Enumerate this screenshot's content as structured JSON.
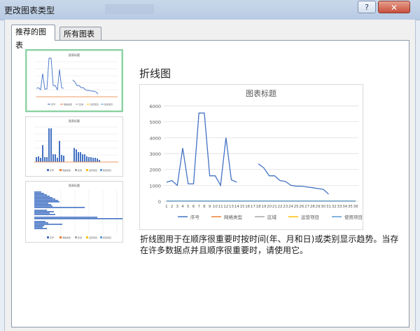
{
  "window": {
    "title": "更改图表类型",
    "help_label": "?",
    "close_label": "✕"
  },
  "tabs": [
    {
      "label": "推荐的图表",
      "active": true
    },
    {
      "label": "所有图表",
      "active": false
    }
  ],
  "selected_chart": {
    "type_name": "折线图",
    "description": "折线图用于在顺序很重要时按时间(年、月和日)或类别显示趋势。当存在许多数据点并且顺序很重要时，请使用它。"
  },
  "chart_data": {
    "type": "line",
    "title": "图表标题",
    "categories": [
      "1",
      "2",
      "3",
      "4",
      "5",
      "6",
      "7",
      "8",
      "9",
      "10",
      "11",
      "12",
      "13",
      "14",
      "15",
      "16",
      "17",
      "18",
      "19",
      "20",
      "21",
      "22",
      "23",
      "24",
      "25",
      "26",
      "27",
      "28",
      "29",
      "30",
      "31",
      "32",
      "33",
      "34",
      "35",
      "36"
    ],
    "ylim": [
      0,
      6000
    ],
    "yticks": [
      0,
      1000,
      2000,
      3000,
      4000,
      5000,
      6000
    ],
    "grid": true,
    "legend_position": "bottom",
    "series": [
      {
        "name": "序号",
        "color": "#4472c4",
        "values": [
          1200,
          1300,
          1000,
          3350,
          1100,
          1100,
          5550,
          5550,
          1600,
          1600,
          1000,
          4000,
          1350,
          1200,
          null,
          null,
          null,
          2350,
          2100,
          1600,
          1600,
          1300,
          1250,
          1000,
          950,
          950,
          900,
          850,
          800,
          750,
          450,
          null,
          null,
          null,
          null,
          null
        ]
      },
      {
        "name": "网络类型",
        "color": "#ed7d31",
        "values": [
          10,
          10,
          10,
          10,
          10,
          10,
          10,
          10,
          10,
          10,
          10,
          10,
          10,
          10,
          10,
          10,
          10,
          10,
          10,
          10,
          10,
          10,
          10,
          10,
          10,
          10,
          10,
          10,
          10,
          10,
          10,
          10,
          10,
          10,
          10,
          10
        ]
      },
      {
        "name": "区域",
        "color": "#a5a5a5",
        "values": [
          5,
          5,
          5,
          5,
          5,
          5,
          5,
          5,
          5,
          5,
          5,
          5,
          5,
          5,
          5,
          5,
          5,
          5,
          5,
          5,
          5,
          5,
          5,
          5,
          5,
          5,
          5,
          5,
          5,
          5,
          5,
          5,
          5,
          5,
          5,
          5
        ]
      },
      {
        "name": "运营项目",
        "color": "#ffc000",
        "values": [
          20,
          20,
          20,
          20,
          20,
          20,
          20,
          20,
          20,
          20,
          20,
          20,
          20,
          20,
          20,
          20,
          20,
          20,
          20,
          20,
          20,
          20,
          20,
          20,
          20,
          20,
          20,
          20,
          20,
          20,
          20,
          20,
          20,
          20,
          20,
          20
        ]
      },
      {
        "name": "使用项目",
        "color": "#5b9bd5",
        "values": [
          15,
          15,
          15,
          15,
          15,
          15,
          15,
          15,
          15,
          15,
          15,
          15,
          15,
          15,
          15,
          15,
          15,
          15,
          15,
          15,
          15,
          15,
          15,
          15,
          15,
          15,
          15,
          15,
          15,
          15,
          15,
          15,
          15,
          15,
          15,
          15
        ]
      }
    ]
  }
}
